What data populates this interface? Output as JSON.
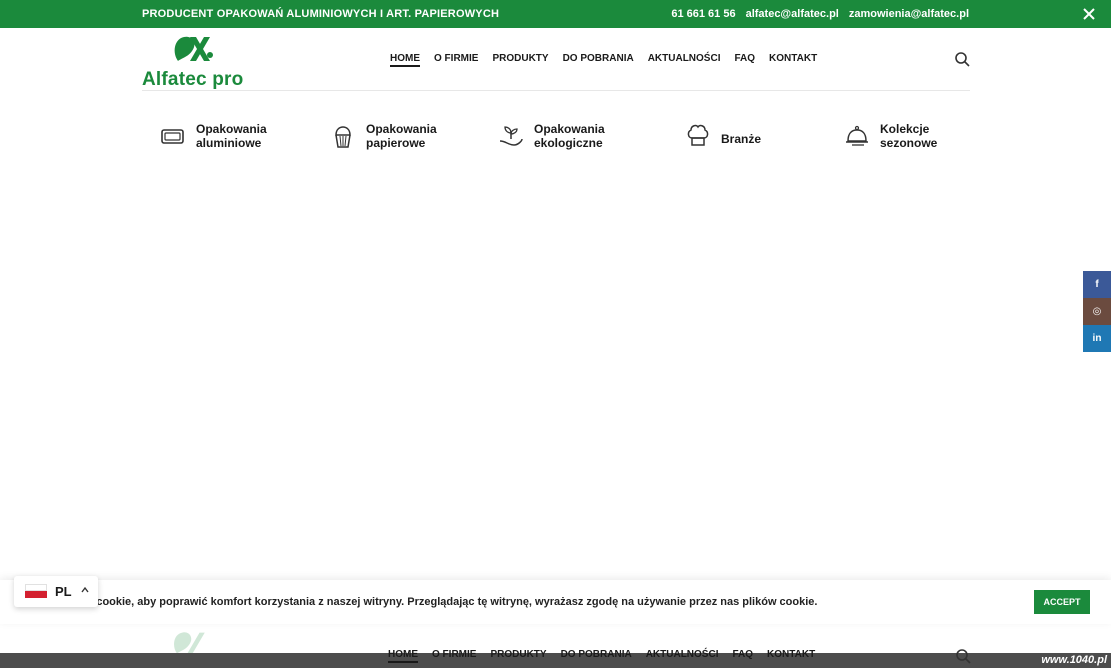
{
  "topbar": {
    "left_text": "PRODUCENT OPAKOWAŃ ALUMINIOWYCH I ART. PAPIEROWYCH",
    "phone": "61 661 61 56",
    "email1": "alfatec@alfatec.pl",
    "email2": "zamowienia@alfatec.pl",
    "close_icon": "close-icon"
  },
  "brand": {
    "name": "Alfatec pro",
    "color": "#1b8a3c"
  },
  "nav": {
    "items": [
      "HOME",
      "O FIRMIE",
      "PRODUKTY",
      "DO POBRANIA",
      "AKTUALNOŚCI",
      "FAQ",
      "KONTAKT"
    ],
    "active": "HOME",
    "search_icon": "search-icon"
  },
  "categories": [
    {
      "line1": "Opakowania",
      "line2": "aluminiowe",
      "icon": "tray-icon"
    },
    {
      "line1": "Opakowania",
      "line2": "papierowe",
      "icon": "cupcake-icon"
    },
    {
      "line1": "Opakowania",
      "line2": "ekologiczne",
      "icon": "plant-hand-icon"
    },
    {
      "line1": "Branże",
      "line2": "",
      "icon": "chef-hat-icon"
    },
    {
      "line1": "Kolekcje",
      "line2": "sezonowe",
      "icon": "cloche-icon"
    }
  ],
  "social": {
    "facebook": "f",
    "instagram": "◎",
    "linkedin": "in"
  },
  "cookie": {
    "text": "ów cookie, aby poprawić komfort korzystania z naszej witryny. Przeglądając tę witrynę, wyrażasz zgodę na używanie przez nas plików cookie.",
    "accept_label": "ACCEPT"
  },
  "language": {
    "code": "PL"
  },
  "watermark": "www.1040.pl"
}
